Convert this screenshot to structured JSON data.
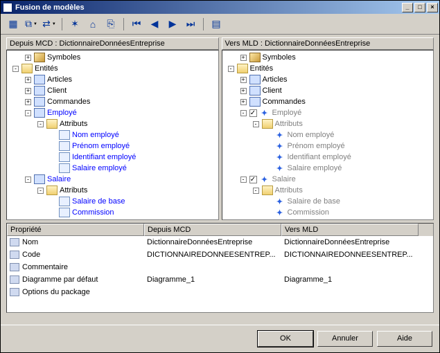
{
  "window": {
    "title": "Fusion de modèles"
  },
  "toolbar": {
    "items": [
      {
        "name": "open-icon",
        "glyph": "▦"
      },
      {
        "name": "copy-icon",
        "glyph": "⧉",
        "dropdown": true
      },
      {
        "name": "compare-icon",
        "glyph": "⇄",
        "dropdown": true
      },
      {
        "sep": true
      },
      {
        "name": "new-icon",
        "glyph": "✶"
      },
      {
        "name": "tag-icon",
        "glyph": "⌂"
      },
      {
        "name": "bookmark-icon",
        "glyph": "⎘"
      },
      {
        "sep": true
      },
      {
        "name": "nav-first-icon",
        "glyph": "⏮"
      },
      {
        "name": "nav-prev-icon",
        "glyph": "◀"
      },
      {
        "name": "nav-next-icon",
        "glyph": "▶"
      },
      {
        "name": "nav-last-icon",
        "glyph": "⏭"
      },
      {
        "sep": true
      },
      {
        "name": "report-icon",
        "glyph": "▤"
      }
    ]
  },
  "left": {
    "title": "Depuis MCD : DictionnaireDonnéesEntreprise",
    "nodes": [
      {
        "depth": 1,
        "exp": "+",
        "icon": "package",
        "label": "Symboles"
      },
      {
        "depth": 0,
        "exp": "-",
        "icon": "folder",
        "label": "Entités"
      },
      {
        "depth": 1,
        "exp": "+",
        "icon": "entity",
        "label": "Articles"
      },
      {
        "depth": 1,
        "exp": "+",
        "icon": "entity",
        "label": "Client"
      },
      {
        "depth": 1,
        "exp": "+",
        "icon": "entity",
        "label": "Commandes"
      },
      {
        "depth": 1,
        "exp": "-",
        "icon": "entity",
        "label": "Employé",
        "cls": "blue"
      },
      {
        "depth": 2,
        "exp": "-",
        "icon": "folder",
        "label": "Attributs"
      },
      {
        "depth": 3,
        "exp": "",
        "icon": "attr",
        "label": "Nom employé",
        "cls": "blue"
      },
      {
        "depth": 3,
        "exp": "",
        "icon": "attr",
        "label": "Prénom employé",
        "cls": "blue"
      },
      {
        "depth": 3,
        "exp": "",
        "icon": "attr",
        "label": "Identifiant employé",
        "cls": "blue"
      },
      {
        "depth": 3,
        "exp": "",
        "icon": "attr",
        "label": "Salaire employé",
        "cls": "blue"
      },
      {
        "depth": 1,
        "exp": "-",
        "icon": "entity",
        "label": "Salaire",
        "cls": "blue"
      },
      {
        "depth": 2,
        "exp": "-",
        "icon": "folder",
        "label": "Attributs"
      },
      {
        "depth": 3,
        "exp": "",
        "icon": "attr",
        "label": "Salaire de base",
        "cls": "blue"
      },
      {
        "depth": 3,
        "exp": "",
        "icon": "attr",
        "label": "Commission",
        "cls": "blue"
      }
    ]
  },
  "right": {
    "title": "Vers MLD : DictionnaireDonnéesEntreprise",
    "nodes": [
      {
        "depth": 1,
        "exp": "+",
        "icon": "package",
        "label": "Symboles"
      },
      {
        "depth": 0,
        "exp": "-",
        "icon": "folder",
        "label": "Entités"
      },
      {
        "depth": 1,
        "exp": "+",
        "icon": "entity",
        "label": "Articles"
      },
      {
        "depth": 1,
        "exp": "+",
        "icon": "entity",
        "label": "Client"
      },
      {
        "depth": 1,
        "exp": "+",
        "icon": "entity",
        "label": "Commandes"
      },
      {
        "depth": 1,
        "exp": "-",
        "check": true,
        "icon": "sync",
        "label": "Employé",
        "cls": "gray"
      },
      {
        "depth": 2,
        "exp": "-",
        "icon": "folder",
        "label": "Attributs",
        "cls": "gray"
      },
      {
        "depth": 3,
        "exp": "",
        "icon": "sync",
        "label": "Nom employé",
        "cls": "gray"
      },
      {
        "depth": 3,
        "exp": "",
        "icon": "sync",
        "label": "Prénom employé",
        "cls": "gray"
      },
      {
        "depth": 3,
        "exp": "",
        "icon": "sync",
        "label": "Identifiant employé",
        "cls": "gray"
      },
      {
        "depth": 3,
        "exp": "",
        "icon": "sync",
        "label": "Salaire employé",
        "cls": "gray"
      },
      {
        "depth": 1,
        "exp": "-",
        "check": true,
        "icon": "sync",
        "label": "Salaire",
        "cls": "gray"
      },
      {
        "depth": 2,
        "exp": "-",
        "icon": "folder",
        "label": "Attributs",
        "cls": "gray"
      },
      {
        "depth": 3,
        "exp": "",
        "icon": "sync",
        "label": "Salaire de base",
        "cls": "gray"
      },
      {
        "depth": 3,
        "exp": "",
        "icon": "sync",
        "label": "Commission",
        "cls": "gray"
      }
    ]
  },
  "properties": {
    "headers": [
      "Propriété",
      "Depuis MCD",
      "Vers MLD"
    ],
    "rows": [
      {
        "name": "Nom",
        "from": "DictionnaireDonnéesEntreprise",
        "to": "DictionnaireDonnéesEntreprise"
      },
      {
        "name": "Code",
        "from": "DICTIONNAIREDONNEESENTREP...",
        "to": "DICTIONNAIREDONNEESENTREP..."
      },
      {
        "name": "Commentaire",
        "from": "",
        "to": ""
      },
      {
        "name": "Diagramme par défaut",
        "from": "Diagramme_1",
        "to": "Diagramme_1"
      },
      {
        "name": "Options du package",
        "from": "",
        "to": ""
      }
    ]
  },
  "buttons": {
    "ok": "OK",
    "cancel": "Annuler",
    "help": "Aide"
  }
}
